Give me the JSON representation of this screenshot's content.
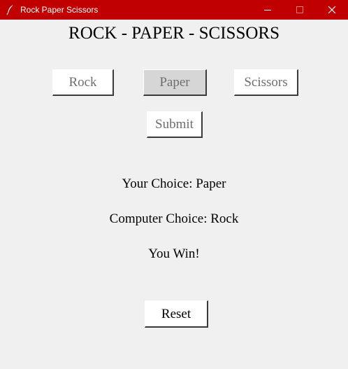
{
  "window": {
    "title": "Rock Paper Scissors",
    "titlebar_color": "#c00000",
    "app_icon": "feather-icon",
    "controls": [
      "minimize-icon",
      "maximize-icon",
      "close-icon"
    ]
  },
  "heading": "ROCK - PAPER - SCISSORS",
  "choices": [
    {
      "label": "Rock",
      "selected": false
    },
    {
      "label": "Paper",
      "selected": true
    },
    {
      "label": "Scissors",
      "selected": false
    }
  ],
  "submit_label": "Submit",
  "status": {
    "your_choice": "Your Choice: Paper",
    "computer_choice": "Computer Choice: Rock",
    "result": "You Win!"
  },
  "reset_label": "Reset"
}
